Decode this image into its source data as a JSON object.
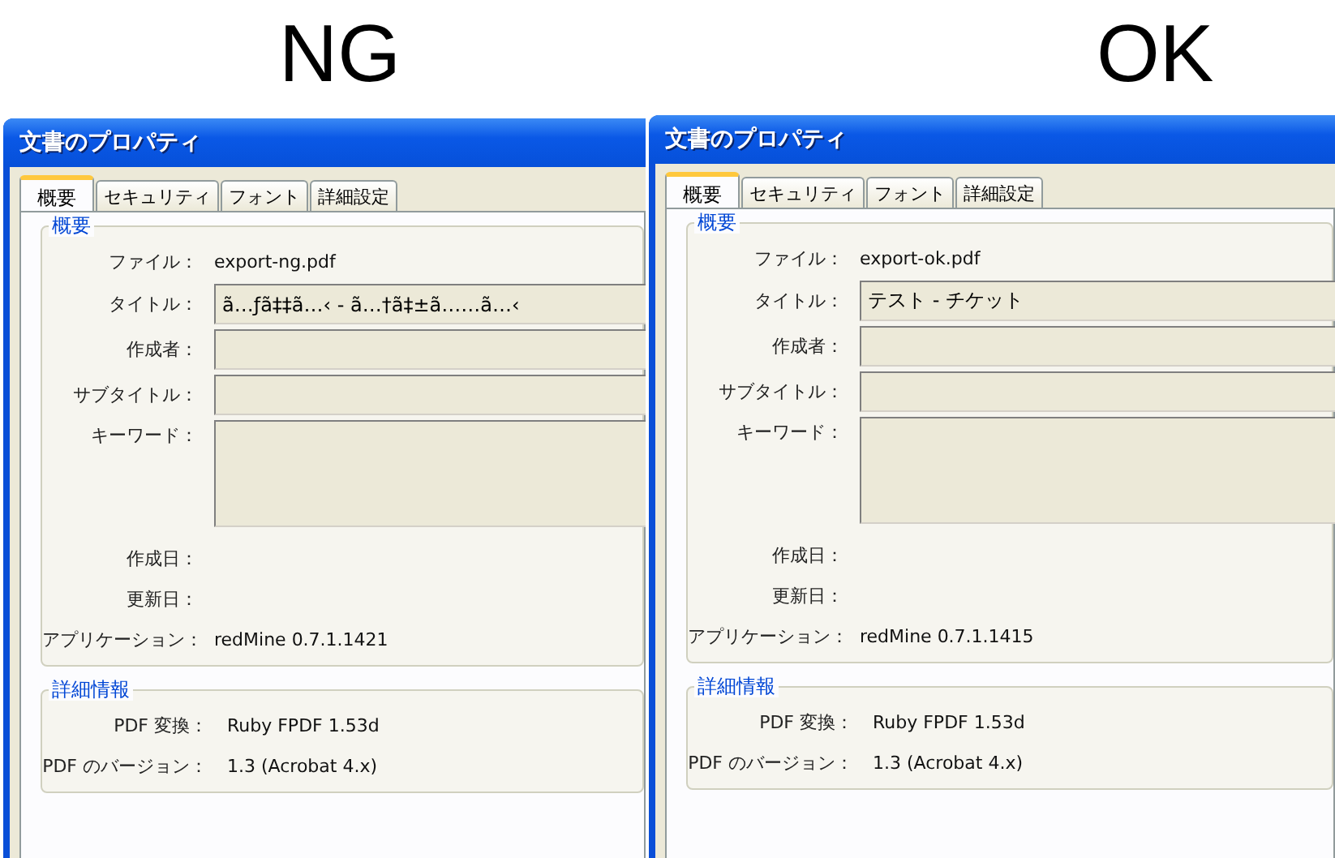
{
  "panels": [
    {
      "heading": "NG",
      "dialog": {
        "title": "文書のプロパティ",
        "tabs": [
          {
            "label": "概要",
            "selected": true
          },
          {
            "label": "セキュリティ",
            "selected": false
          },
          {
            "label": "フォント",
            "selected": false
          },
          {
            "label": "詳細設定",
            "selected": false
          }
        ],
        "summary": {
          "legend": "概要",
          "rows": [
            {
              "label": "ファイル：",
              "kind": "text",
              "value": "export-ng.pdf"
            },
            {
              "label": "タイトル：",
              "kind": "field",
              "value": "ã…ƒã‡‡ã…‹ - ã…†ã‡±ã……ã…‹"
            },
            {
              "label": "作成者：",
              "kind": "field"
            },
            {
              "label": "サブタイトル：",
              "kind": "field"
            },
            {
              "label": "キーワード：",
              "kind": "area"
            },
            {
              "label": "作成日：",
              "kind": "text"
            },
            {
              "label": "更新日：",
              "kind": "text"
            },
            {
              "label": "アプリケーション：",
              "kind": "text",
              "value": "redMine 0.7.1.1421"
            }
          ]
        },
        "details": {
          "legend": "詳細情報",
          "rows": [
            {
              "label": "PDF 変換：",
              "kind": "text",
              "value": "Ruby FPDF 1.53d"
            },
            {
              "label": "PDF のバージョン：",
              "kind": "text",
              "value": "1.3 (Acrobat 4.x)"
            }
          ]
        }
      }
    },
    {
      "heading": "OK",
      "dialog": {
        "title": "文書のプロパティ",
        "tabs": [
          {
            "label": "概要",
            "selected": true
          },
          {
            "label": "セキュリティ",
            "selected": false
          },
          {
            "label": "フォント",
            "selected": false
          },
          {
            "label": "詳細設定",
            "selected": false
          }
        ],
        "summary": {
          "legend": "概要",
          "rows": [
            {
              "label": "ファイル：",
              "kind": "text",
              "value": "export-ok.pdf"
            },
            {
              "label": "タイトル：",
              "kind": "field",
              "value": "テスト - チケット"
            },
            {
              "label": "作成者：",
              "kind": "field"
            },
            {
              "label": "サブタイトル：",
              "kind": "field"
            },
            {
              "label": "キーワード：",
              "kind": "area"
            },
            {
              "label": "作成日：",
              "kind": "text"
            },
            {
              "label": "更新日：",
              "kind": "text"
            },
            {
              "label": "アプリケーション：",
              "kind": "text",
              "value": "redMine 0.7.1.1415"
            }
          ]
        },
        "details": {
          "legend": "詳細情報",
          "rows": [
            {
              "label": "PDF 変換：",
              "kind": "text",
              "value": "Ruby FPDF 1.53d"
            },
            {
              "label": "PDF のバージョン：",
              "kind": "text",
              "value": "1.3 (Acrobat 4.x)"
            }
          ]
        }
      }
    }
  ]
}
